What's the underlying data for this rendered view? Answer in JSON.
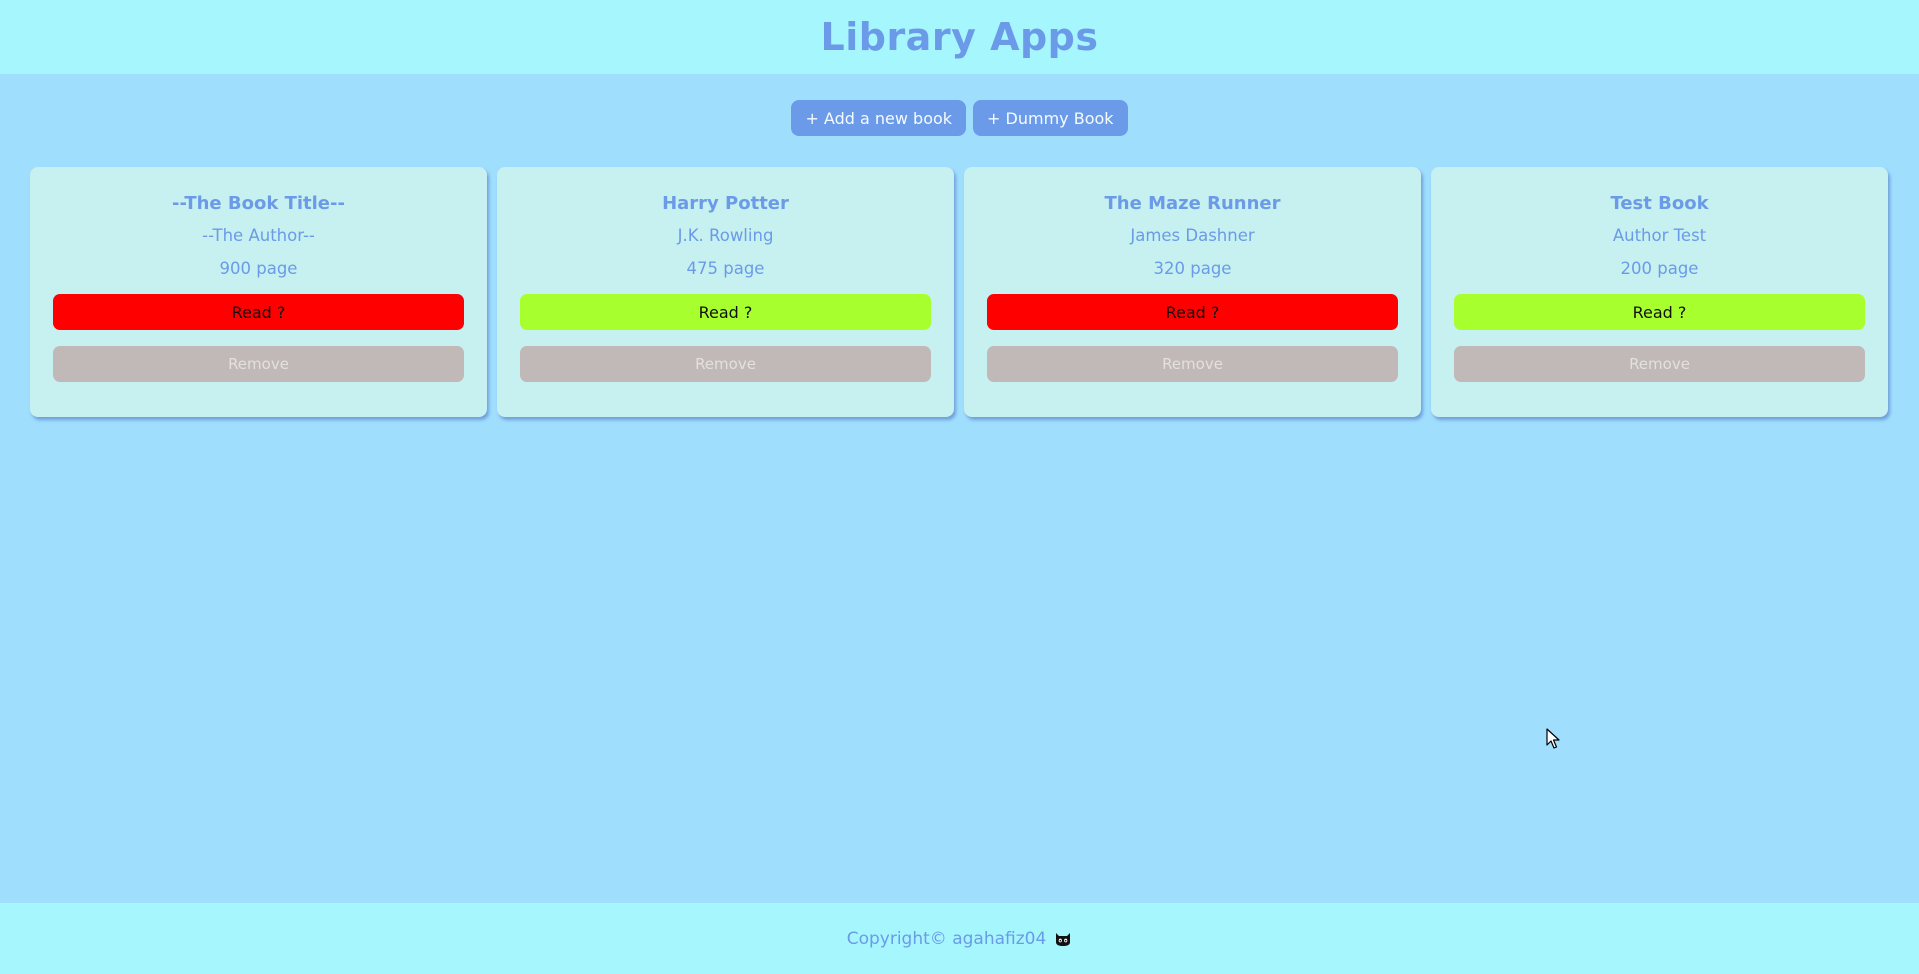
{
  "header": {
    "title": "Library Apps"
  },
  "actions": {
    "add_label": "+ Add a new book",
    "dummy_label": "+ Dummy Book"
  },
  "books": [
    {
      "title": "--The Book Title--",
      "author": "--The Author--",
      "pages": "900 page",
      "read_label": "Read ?",
      "read": false,
      "remove_label": "Remove"
    },
    {
      "title": "Harry Potter",
      "author": "J.K. Rowling",
      "pages": "475 page",
      "read_label": "Read ?",
      "read": true,
      "remove_label": "Remove"
    },
    {
      "title": "The Maze Runner",
      "author": "James Dashner",
      "pages": "320 page",
      "read_label": "Read ?",
      "read": false,
      "remove_label": "Remove"
    },
    {
      "title": "Test Book",
      "author": "Author Test",
      "pages": "200 page",
      "read_label": "Read ?",
      "read": true,
      "remove_label": "Remove"
    }
  ],
  "footer": {
    "text": "Copyright© agahafiz04",
    "icon": "github-icon"
  },
  "colors": {
    "header_bg": "#a6f6fe",
    "page_bg": "#a0defe",
    "accent": "#6b9be8",
    "card_bg": "#c7f0f0",
    "read_true": "#a8ff2e",
    "read_false": "#ff0000",
    "remove_bg": "#c1b8b8"
  }
}
